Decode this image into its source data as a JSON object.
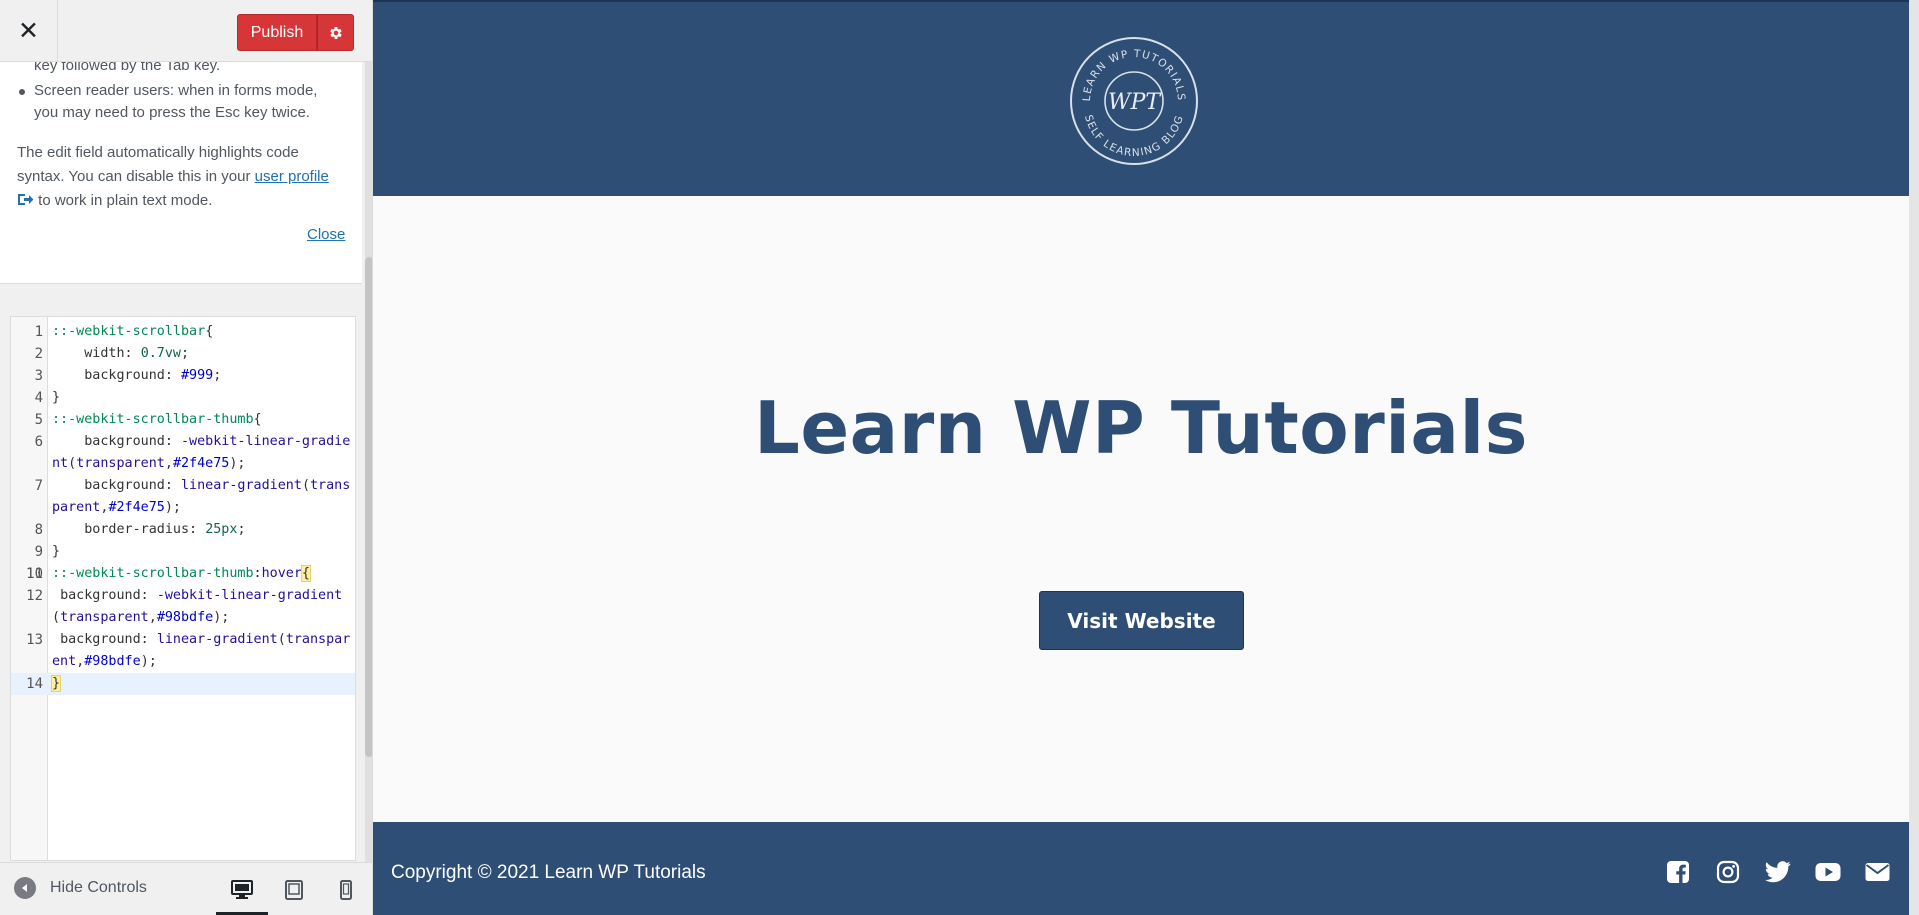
{
  "colors": {
    "primary": "#2f4e75",
    "publish": "#d63638",
    "link": "#2271b1"
  },
  "customizer": {
    "close_icon": "close-icon",
    "publish_label": "Publish",
    "settings_icon": "gear-icon",
    "help": {
      "cut_line": "key followed by the Tab key.",
      "bullet": "Screen reader users: when in forms mode, you may need to press the Esc key twice.",
      "para_before": "The edit field automatically highlights code syntax. You can disable this in your ",
      "link_text": "user profile",
      "link_icon": "external-link-icon",
      "para_after": " to work in plain text mode.",
      "close_label": "Close"
    },
    "editor": {
      "lines": [
        [
          "1",
          "::-webkit-scrollbar{"
        ],
        [
          "2",
          "    width: 0.7vw;"
        ],
        [
          "3",
          "    background: #999;"
        ],
        [
          "4",
          "}"
        ],
        [
          "5",
          "::-webkit-scrollbar-thumb{"
        ],
        [
          "6",
          "    background: -webkit-linear-gradient(transparent,#2f4e75);"
        ],
        [
          "7",
          "    background: linear-gradient(transparent,#2f4e75);"
        ],
        [
          "8",
          "    border-radius: 25px;"
        ],
        [
          "9",
          "}"
        ],
        [
          "10",
          ""
        ],
        [
          "11",
          "::-webkit-scrollbar-thumb:hover{"
        ],
        [
          "12",
          " background: -webkit-linear-gradient(transparent,#98bdfe);"
        ],
        [
          "13",
          " background: linear-gradient(transparent,#98bdfe);"
        ],
        [
          "14",
          "}"
        ]
      ]
    },
    "bottom": {
      "hide_controls": "Hide Controls",
      "devices": [
        "desktop-icon",
        "tablet-icon",
        "mobile-icon"
      ],
      "active_device": "desktop"
    }
  },
  "preview": {
    "logo": {
      "top_text": "LEARN WP TUTORIALS",
      "bottom_text": "SELF LEARNING BLOG",
      "monogram": "WPT"
    },
    "hero_title": "Learn WP Tutorials",
    "cta": "Visit Website",
    "copyright": "Copyright © 2021 Learn WP Tutorials",
    "social_icons": [
      "facebook-icon",
      "instagram-icon",
      "twitter-icon",
      "youtube-icon",
      "email-icon"
    ]
  }
}
